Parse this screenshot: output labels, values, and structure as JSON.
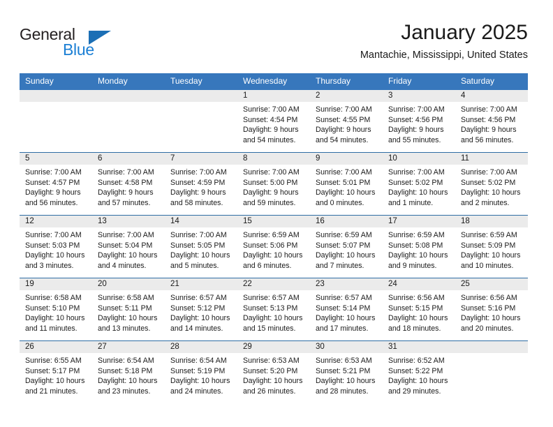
{
  "logo": {
    "word_one": "General",
    "word_two": "Blue",
    "triangle_icon": "triangle-icon"
  },
  "header": {
    "title": "January 2025",
    "location": "Mantachie, Mississippi, United States"
  },
  "calendar": {
    "weekday_headers": [
      "Sunday",
      "Monday",
      "Tuesday",
      "Wednesday",
      "Thursday",
      "Friday",
      "Saturday"
    ],
    "colors": {
      "header_blue": "#3777bc",
      "separator_blue": "#2e6da4",
      "number_band_gray": "#ebebeb",
      "logo_blue": "#1b7fd4"
    },
    "labels": {
      "sunrise": "Sunrise:",
      "sunset": "Sunset:",
      "daylight": "Daylight:"
    },
    "weeks": [
      [
        {
          "day": "",
          "empty": true
        },
        {
          "day": "",
          "empty": true
        },
        {
          "day": "",
          "empty": true
        },
        {
          "day": "1",
          "sunrise": "Sunrise: 7:00 AM",
          "sunset": "Sunset: 4:54 PM",
          "daylight_line1": "Daylight: 9 hours",
          "daylight_line2": "and 54 minutes."
        },
        {
          "day": "2",
          "sunrise": "Sunrise: 7:00 AM",
          "sunset": "Sunset: 4:55 PM",
          "daylight_line1": "Daylight: 9 hours",
          "daylight_line2": "and 54 minutes."
        },
        {
          "day": "3",
          "sunrise": "Sunrise: 7:00 AM",
          "sunset": "Sunset: 4:56 PM",
          "daylight_line1": "Daylight: 9 hours",
          "daylight_line2": "and 55 minutes."
        },
        {
          "day": "4",
          "sunrise": "Sunrise: 7:00 AM",
          "sunset": "Sunset: 4:56 PM",
          "daylight_line1": "Daylight: 9 hours",
          "daylight_line2": "and 56 minutes."
        }
      ],
      [
        {
          "day": "5",
          "sunrise": "Sunrise: 7:00 AM",
          "sunset": "Sunset: 4:57 PM",
          "daylight_line1": "Daylight: 9 hours",
          "daylight_line2": "and 56 minutes."
        },
        {
          "day": "6",
          "sunrise": "Sunrise: 7:00 AM",
          "sunset": "Sunset: 4:58 PM",
          "daylight_line1": "Daylight: 9 hours",
          "daylight_line2": "and 57 minutes."
        },
        {
          "day": "7",
          "sunrise": "Sunrise: 7:00 AM",
          "sunset": "Sunset: 4:59 PM",
          "daylight_line1": "Daylight: 9 hours",
          "daylight_line2": "and 58 minutes."
        },
        {
          "day": "8",
          "sunrise": "Sunrise: 7:00 AM",
          "sunset": "Sunset: 5:00 PM",
          "daylight_line1": "Daylight: 9 hours",
          "daylight_line2": "and 59 minutes."
        },
        {
          "day": "9",
          "sunrise": "Sunrise: 7:00 AM",
          "sunset": "Sunset: 5:01 PM",
          "daylight_line1": "Daylight: 10 hours",
          "daylight_line2": "and 0 minutes."
        },
        {
          "day": "10",
          "sunrise": "Sunrise: 7:00 AM",
          "sunset": "Sunset: 5:02 PM",
          "daylight_line1": "Daylight: 10 hours",
          "daylight_line2": "and 1 minute."
        },
        {
          "day": "11",
          "sunrise": "Sunrise: 7:00 AM",
          "sunset": "Sunset: 5:02 PM",
          "daylight_line1": "Daylight: 10 hours",
          "daylight_line2": "and 2 minutes."
        }
      ],
      [
        {
          "day": "12",
          "sunrise": "Sunrise: 7:00 AM",
          "sunset": "Sunset: 5:03 PM",
          "daylight_line1": "Daylight: 10 hours",
          "daylight_line2": "and 3 minutes."
        },
        {
          "day": "13",
          "sunrise": "Sunrise: 7:00 AM",
          "sunset": "Sunset: 5:04 PM",
          "daylight_line1": "Daylight: 10 hours",
          "daylight_line2": "and 4 minutes."
        },
        {
          "day": "14",
          "sunrise": "Sunrise: 7:00 AM",
          "sunset": "Sunset: 5:05 PM",
          "daylight_line1": "Daylight: 10 hours",
          "daylight_line2": "and 5 minutes."
        },
        {
          "day": "15",
          "sunrise": "Sunrise: 6:59 AM",
          "sunset": "Sunset: 5:06 PM",
          "daylight_line1": "Daylight: 10 hours",
          "daylight_line2": "and 6 minutes."
        },
        {
          "day": "16",
          "sunrise": "Sunrise: 6:59 AM",
          "sunset": "Sunset: 5:07 PM",
          "daylight_line1": "Daylight: 10 hours",
          "daylight_line2": "and 7 minutes."
        },
        {
          "day": "17",
          "sunrise": "Sunrise: 6:59 AM",
          "sunset": "Sunset: 5:08 PM",
          "daylight_line1": "Daylight: 10 hours",
          "daylight_line2": "and 9 minutes."
        },
        {
          "day": "18",
          "sunrise": "Sunrise: 6:59 AM",
          "sunset": "Sunset: 5:09 PM",
          "daylight_line1": "Daylight: 10 hours",
          "daylight_line2": "and 10 minutes."
        }
      ],
      [
        {
          "day": "19",
          "sunrise": "Sunrise: 6:58 AM",
          "sunset": "Sunset: 5:10 PM",
          "daylight_line1": "Daylight: 10 hours",
          "daylight_line2": "and 11 minutes."
        },
        {
          "day": "20",
          "sunrise": "Sunrise: 6:58 AM",
          "sunset": "Sunset: 5:11 PM",
          "daylight_line1": "Daylight: 10 hours",
          "daylight_line2": "and 13 minutes."
        },
        {
          "day": "21",
          "sunrise": "Sunrise: 6:57 AM",
          "sunset": "Sunset: 5:12 PM",
          "daylight_line1": "Daylight: 10 hours",
          "daylight_line2": "and 14 minutes."
        },
        {
          "day": "22",
          "sunrise": "Sunrise: 6:57 AM",
          "sunset": "Sunset: 5:13 PM",
          "daylight_line1": "Daylight: 10 hours",
          "daylight_line2": "and 15 minutes."
        },
        {
          "day": "23",
          "sunrise": "Sunrise: 6:57 AM",
          "sunset": "Sunset: 5:14 PM",
          "daylight_line1": "Daylight: 10 hours",
          "daylight_line2": "and 17 minutes."
        },
        {
          "day": "24",
          "sunrise": "Sunrise: 6:56 AM",
          "sunset": "Sunset: 5:15 PM",
          "daylight_line1": "Daylight: 10 hours",
          "daylight_line2": "and 18 minutes."
        },
        {
          "day": "25",
          "sunrise": "Sunrise: 6:56 AM",
          "sunset": "Sunset: 5:16 PM",
          "daylight_line1": "Daylight: 10 hours",
          "daylight_line2": "and 20 minutes."
        }
      ],
      [
        {
          "day": "26",
          "sunrise": "Sunrise: 6:55 AM",
          "sunset": "Sunset: 5:17 PM",
          "daylight_line1": "Daylight: 10 hours",
          "daylight_line2": "and 21 minutes."
        },
        {
          "day": "27",
          "sunrise": "Sunrise: 6:54 AM",
          "sunset": "Sunset: 5:18 PM",
          "daylight_line1": "Daylight: 10 hours",
          "daylight_line2": "and 23 minutes."
        },
        {
          "day": "28",
          "sunrise": "Sunrise: 6:54 AM",
          "sunset": "Sunset: 5:19 PM",
          "daylight_line1": "Daylight: 10 hours",
          "daylight_line2": "and 24 minutes."
        },
        {
          "day": "29",
          "sunrise": "Sunrise: 6:53 AM",
          "sunset": "Sunset: 5:20 PM",
          "daylight_line1": "Daylight: 10 hours",
          "daylight_line2": "and 26 minutes."
        },
        {
          "day": "30",
          "sunrise": "Sunrise: 6:53 AM",
          "sunset": "Sunset: 5:21 PM",
          "daylight_line1": "Daylight: 10 hours",
          "daylight_line2": "and 28 minutes."
        },
        {
          "day": "31",
          "sunrise": "Sunrise: 6:52 AM",
          "sunset": "Sunset: 5:22 PM",
          "daylight_line1": "Daylight: 10 hours",
          "daylight_line2": "and 29 minutes."
        },
        {
          "day": "",
          "empty": true
        }
      ]
    ]
  }
}
